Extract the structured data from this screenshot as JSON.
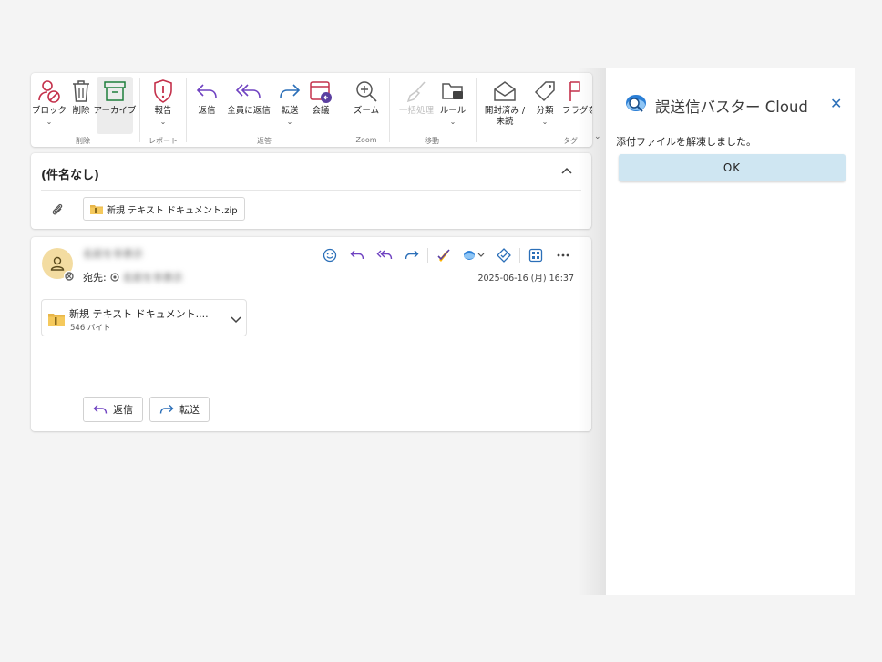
{
  "ribbon": {
    "buttons": {
      "block": "ブロック",
      "delete": "削除",
      "archive": "アーカイブ",
      "report": "報告",
      "reply": "返信",
      "reply_all": "全員に返信",
      "forward": "転送",
      "meeting": "会議",
      "zoom": "ズーム",
      "sweep": "一括処理",
      "rules": "ルール",
      "read_unread": "開封済み /\n未読",
      "categorize": "分類",
      "flag": "フラグを"
    },
    "groups": {
      "delete": "削除",
      "report": "レポート",
      "respond": "返答",
      "zoom": "Zoom",
      "move": "移動",
      "tags": "タグ"
    }
  },
  "subject": {
    "title": "(件名なし)",
    "attachment_chip": "新規 テキスト ドキュメント.zip"
  },
  "message": {
    "sender": "名前を非表示",
    "to_label": "宛先:",
    "to_name": "名前を非表示",
    "timestamp": "2025-06-16 (月) 16:37",
    "attachment": {
      "name": "新規 テキスト ドキュメント....",
      "size": "546 バイト"
    },
    "reply_label": "返信",
    "forward_label": "転送"
  },
  "panel": {
    "title": "誤送信バスター Cloud",
    "message": "添付ファイルを解凍しました。",
    "ok_label": "OK"
  },
  "colors": {
    "accent": "#2b6fb8",
    "ok_button": "#cfe6f2",
    "avatar": "#f3dca1",
    "icon_red": "#c4314b",
    "icon_purple": "#5b3fa0"
  }
}
